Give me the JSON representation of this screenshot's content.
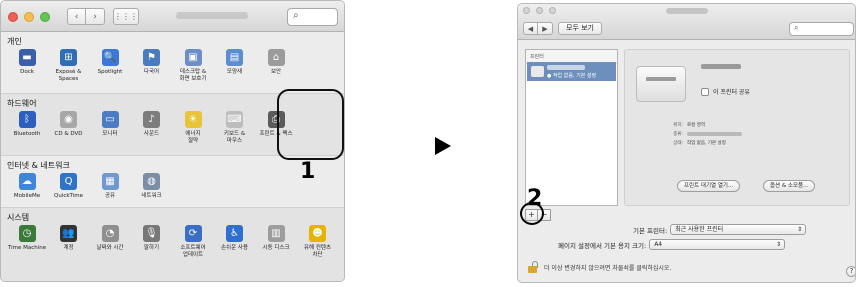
{
  "left_window": {
    "sections": [
      {
        "title": "개인",
        "items": [
          {
            "label": "Dock",
            "icon": "dock-icon",
            "color": "#3a5fa8",
            "glyph": "▬"
          },
          {
            "label": "Exposé &\nSpaces",
            "icon": "expose-icon",
            "color": "#2f6db5",
            "glyph": "⊞"
          },
          {
            "label": "Spotlight",
            "icon": "spotlight-icon",
            "color": "#3c78d8",
            "glyph": "🔍"
          },
          {
            "label": "다국어",
            "icon": "language-flag-icon",
            "color": "#4a7bbf",
            "glyph": "⚑"
          },
          {
            "label": "데스크탑 &\n화면 보호기",
            "icon": "desktop-icon",
            "color": "#6e8fc6",
            "glyph": "▣"
          },
          {
            "label": "모양새",
            "icon": "appearance-icon",
            "color": "#5b8dcf",
            "glyph": "▤"
          },
          {
            "label": "보안",
            "icon": "security-house-icon",
            "color": "#9b9b9b",
            "glyph": "⌂"
          }
        ]
      },
      {
        "title": "하드웨어",
        "items": [
          {
            "label": "Bluetooth",
            "icon": "bluetooth-icon",
            "color": "#2c5fbf",
            "glyph": "ᛒ"
          },
          {
            "label": "CD & DVD",
            "icon": "cd-dvd-icon",
            "color": "#a7a7a7",
            "glyph": "◉"
          },
          {
            "label": "모니터",
            "icon": "monitor-icon",
            "color": "#4b7cc4",
            "glyph": "▭"
          },
          {
            "label": "사운드",
            "icon": "sound-icon",
            "color": "#7d7d7d",
            "glyph": "♪"
          },
          {
            "label": "에너지\n절약",
            "icon": "energy-saver-icon",
            "color": "#e7c43a",
            "glyph": "☀"
          },
          {
            "label": "키보드 &\n마우스",
            "icon": "keyboard-mouse-icon",
            "color": "#bdbdbd",
            "glyph": "⌨"
          },
          {
            "label": "프린트 & 팩스",
            "icon": "printer-icon",
            "color": "#5a5a5a",
            "glyph": "⎙"
          }
        ]
      },
      {
        "title": "인터넷 & 네트워크",
        "items": [
          {
            "label": "MobileMe",
            "icon": "mobileme-icon",
            "color": "#3f86d6",
            "glyph": "☁"
          },
          {
            "label": "QuickTime",
            "icon": "quicktime-icon",
            "color": "#2f74c7",
            "glyph": "Q"
          },
          {
            "label": "공유",
            "icon": "sharing-folder-icon",
            "color": "#6f99cf",
            "glyph": "▦"
          },
          {
            "label": "네트워크",
            "icon": "network-globe-icon",
            "color": "#7c8ea6",
            "glyph": "◍"
          }
        ]
      },
      {
        "title": "시스템",
        "items": [
          {
            "label": "Time Machine",
            "icon": "time-machine-icon",
            "color": "#3a7a3a",
            "glyph": "◷"
          },
          {
            "label": "계정",
            "icon": "accounts-icon",
            "color": "#333333",
            "glyph": "👥"
          },
          {
            "label": "날짜와 시간",
            "icon": "date-time-icon",
            "color": "#8f8f8f",
            "glyph": "◔"
          },
          {
            "label": "말하기",
            "icon": "speech-icon",
            "color": "#777777",
            "glyph": "🎙"
          },
          {
            "label": "소프트웨어\n업데이트",
            "icon": "software-update-icon",
            "color": "#3b6ec4",
            "glyph": "⟳"
          },
          {
            "label": "손쉬운 사용",
            "icon": "accessibility-icon",
            "color": "#2e6fd0",
            "glyph": "♿"
          },
          {
            "label": "시동 디스크",
            "icon": "startup-disk-icon",
            "color": "#9d9d9d",
            "glyph": "▥"
          },
          {
            "label": "유해 컨텐츠\n차단",
            "icon": "parental-controls-icon",
            "color": "#e8b300",
            "glyph": "☻"
          }
        ]
      }
    ]
  },
  "callouts": {
    "step1": "1",
    "step2": "2"
  },
  "right_window": {
    "show_all_label": "모두 보기",
    "printer_list_header": "프린터",
    "selected_printer_status": "● 작업 없음, 기본 설정",
    "share_checkbox_label": "이 프린터 공유",
    "info": [
      {
        "key": "위치:",
        "value": "로컬 영역"
      },
      {
        "key": "종류:",
        "value": ""
      },
      {
        "key": "상태:",
        "value": "작업 없음, 기본 설정"
      }
    ],
    "open_queue_button": "프린트 대기열 열기...",
    "options_button": "옵션 & 소모품...",
    "add_button": "+",
    "remove_button": "−",
    "default_printer_label": "기본 프린터:",
    "default_printer_value": "최근 사용한 프린터",
    "paper_size_label": "페이지 설정에서 기본 용지 크기:",
    "paper_size_value": "A4",
    "lock_text": "더 이상 변경하지 않으려면 자물쇠를 클릭하십시오.",
    "help_button": "?"
  }
}
